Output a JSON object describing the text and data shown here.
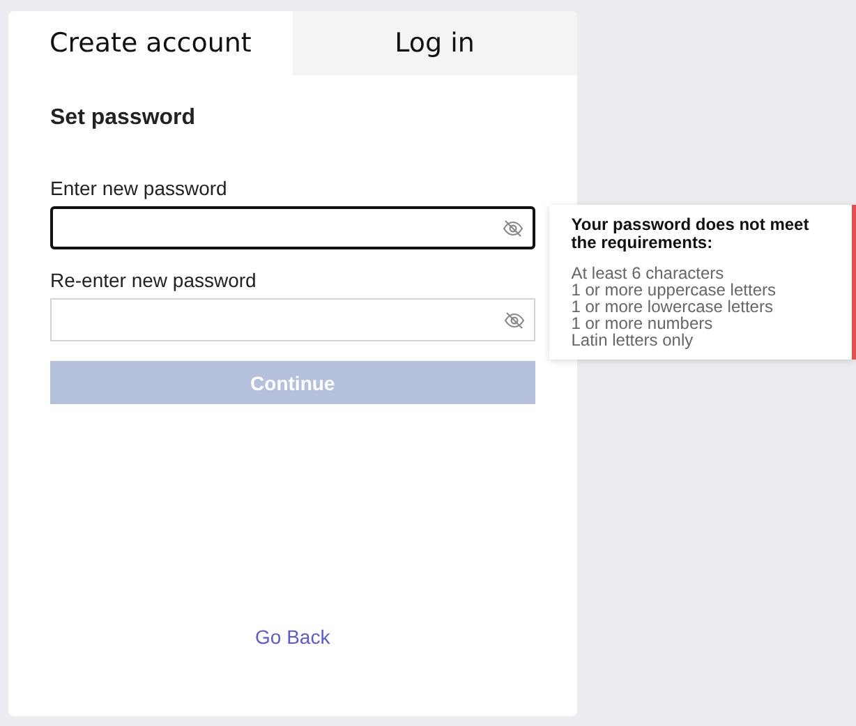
{
  "tabs": [
    {
      "label": "Create account",
      "selected": true
    },
    {
      "label": "Log in",
      "selected": false
    }
  ],
  "form": {
    "title": "Set password",
    "fields": [
      {
        "label": "Enter new password",
        "focused": true
      },
      {
        "label": "Re-enter new password",
        "focused": false
      }
    ],
    "submit": {
      "label": "Continue",
      "disabled": true
    },
    "back_link": "Go Back"
  },
  "tooltip": {
    "title": "Your password does not meet the requirements:",
    "items": [
      "At least 6 characters",
      "1 or more uppercase letters",
      "1 or more lowercase letters",
      "1 or more numbers",
      "Latin letters only"
    ]
  }
}
